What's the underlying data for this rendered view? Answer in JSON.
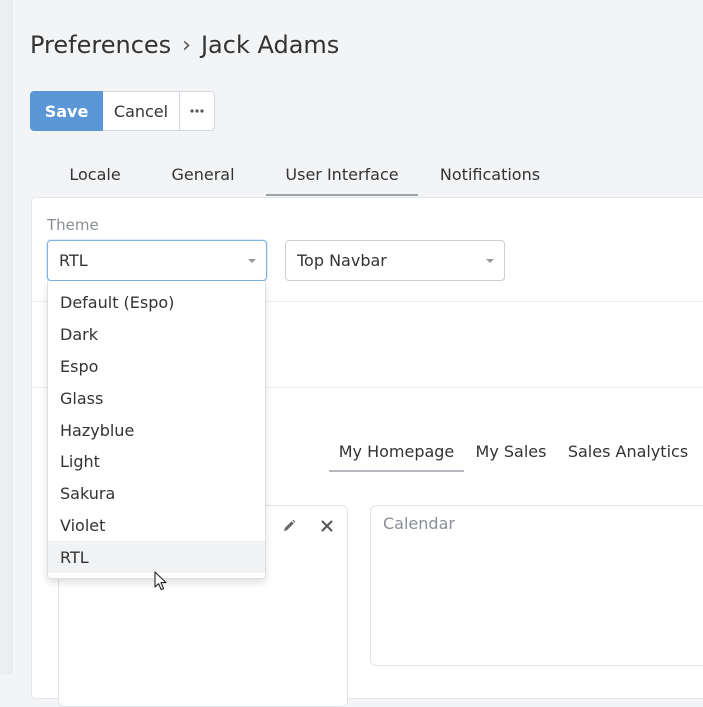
{
  "breadcrumb": {
    "section": "Preferences",
    "separator": "›",
    "user": "Jack Adams"
  },
  "toolbar": {
    "save_label": "Save",
    "cancel_label": "Cancel",
    "more_label": "•••"
  },
  "tabs": [
    {
      "label": "Locale"
    },
    {
      "label": "General"
    },
    {
      "label": "User Interface"
    },
    {
      "label": "Notifications"
    }
  ],
  "theme": {
    "label": "Theme",
    "selected": "RTL",
    "options": [
      "Default (Espo)",
      "Dark",
      "Espo",
      "Glass",
      "Hazyblue",
      "Light",
      "Sakura",
      "Violet",
      "RTL"
    ],
    "hovered": "RTL"
  },
  "navbar": {
    "selected": "Top Navbar"
  },
  "dashboard_tabs": [
    {
      "label": "My Homepage"
    },
    {
      "label": "My Sales"
    },
    {
      "label": "Sales Analytics"
    }
  ],
  "dashlets": {
    "calendar_title": "Calendar"
  },
  "icons": {
    "edit": "pencil-icon",
    "remove": "close-icon",
    "caret": "caret-down-icon",
    "cursor": "mouse-pointer-icon"
  },
  "colors": {
    "primary": "#5b97d6",
    "focus": "#7fb1e3",
    "background": "#f3f4f6"
  }
}
